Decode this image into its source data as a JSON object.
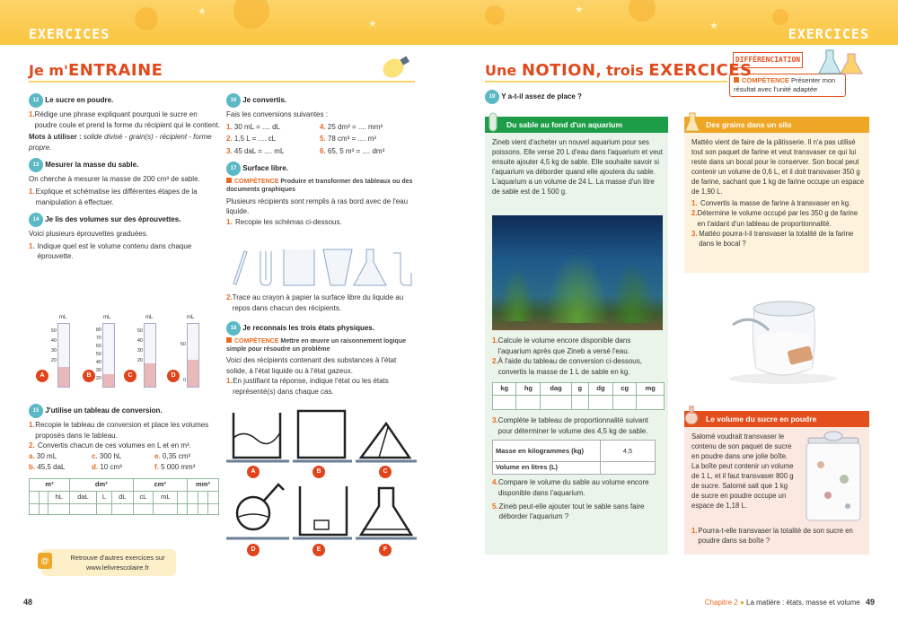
{
  "header": {
    "left": "EXERCICES",
    "right": "EXERCICES"
  },
  "left": {
    "title_a": "Je m'",
    "title_b": "ENTRAINE",
    "ex12": {
      "num": "12",
      "title": "Le sucre en poudre.",
      "q1": "1.",
      "q1_text": "Rédige une phrase expliquant pourquoi le sucre en poudre coule et prend la forme du récipient qui le contient.",
      "mots_label": "Mots à utiliser :",
      "mots": "solide divisé - grain(s) - récipient - forme propre."
    },
    "ex13": {
      "num": "13",
      "title": "Mesurer la masse du sable.",
      "intro": "On cherche à mesurer la masse de 200 cm³ de sable.",
      "q1": "1.",
      "q1_text": "Explique et schématise les différentes étapes de la manipulation à effectuer."
    },
    "ex14": {
      "num": "14",
      "title": "Je lis des volumes sur des éprouvettes.",
      "intro": "Voici plusieurs éprouvettes graduées.",
      "q1": "1.",
      "q1_text": "Indique quel est le volume contenu dans chaque éprouvette.",
      "unit": "mL",
      "labels": [
        "A",
        "B",
        "C",
        "D"
      ],
      "tickA": [
        "50",
        "40",
        "30",
        "20"
      ],
      "tickB": [
        "80",
        "70",
        "60",
        "50",
        "40",
        "30",
        "20"
      ],
      "tickC": [
        "50",
        "40",
        "30",
        "20"
      ],
      "tickD": [
        "50",
        "0"
      ]
    },
    "ex15": {
      "num": "15",
      "title": "J'utilise un tableau de conversion.",
      "q1": "1.",
      "q1_text": "Recopie le tableau de conversion et place les volumes proposés dans le tableau.",
      "q2": "2.",
      "q2_text": "Convertis chacun de ces volumes en L et en m³.",
      "items": [
        [
          "a.",
          "30 mL"
        ],
        [
          "b.",
          "45,5 daL"
        ],
        [
          "c.",
          "300 hL"
        ],
        [
          "d.",
          "10 cm³"
        ],
        [
          "e.",
          "0,35 cm³"
        ],
        [
          "f.",
          "5 000 mm³"
        ]
      ],
      "table_top": [
        "m³",
        "dm³",
        "cm³",
        "mm³"
      ],
      "table_bottom": [
        "hL",
        "daL",
        "L",
        "dL",
        "cL",
        "mL"
      ]
    },
    "ex16": {
      "num": "16",
      "title": "Je convertis.",
      "intro": "Fais les conversions suivantes :",
      "items": [
        [
          "1.",
          "30 mL = .... dL"
        ],
        [
          "2.",
          "1,5 L = .... cL"
        ],
        [
          "3.",
          "45 daL = .... mL"
        ],
        [
          "4.",
          "25 dm³ = .... mm³"
        ],
        [
          "5.",
          "78 cm³ = .... m³"
        ],
        [
          "6.",
          "65, 5 m³ = .... dm³"
        ]
      ]
    },
    "ex17": {
      "num": "17",
      "title": "Surface libre.",
      "comp_label": "COMPÉTENCE",
      "comp_text": "Produire et transformer des tableaux ou des documents graphiques",
      "intro": "Plusieurs récipients sont remplis à ras bord avec de l'eau liquide.",
      "q1": "1.",
      "q1_text": "Recopie les schémas ci-dessous.",
      "q2": "2.",
      "q2_text": "Trace au crayon à papier la surface libre du liquide au repos dans chacun des récipients."
    },
    "ex18": {
      "num": "18",
      "title": "Je reconnais les trois états physiques.",
      "comp_label": "COMPÉTENCE",
      "comp_text": "Mettre en œuvre un raisonnement logique simple pour résoudre un problème",
      "intro": "Voici des récipients contenant des substances à l'état solide, à l'état liquide ou à l'état gazeux.",
      "q1": "1.",
      "q1_text": "En justifiant ta réponse, indique l'état ou les états représenté(s) dans chaque cas.",
      "labels": [
        "A",
        "B",
        "C",
        "D",
        "E",
        "F"
      ]
    },
    "footer_note": "Retrouve d'autres exercices sur www.lelivrescolaire.fr",
    "page": "48"
  },
  "right": {
    "title_a": "Une ",
    "title_b": "NOTION",
    ", trois ": "",
    "title_c": ", trois ",
    "title_d": "EXERCICES",
    "diff": {
      "label": "DIFFÉRENCIATION",
      "comp_label": "COMPÉTENCE",
      "comp_text": "Présenter mon résultat avec l'unité adaptée"
    },
    "ex19": {
      "num": "19",
      "title": "Y a-t-il assez de place ?"
    },
    "aquarium": {
      "title": "Du sable au fond d'un aquarium",
      "text": "Zineb vient d'acheter un nouvel aquarium pour ses poissons. Elle verse 20 L d'eau dans l'aquarium et veut ensuite ajouter 4,5 kg de sable. Elle souhaite savoir si l'aquarium va déborder quand elle ajoutera du sable. L'aquarium a un volume de 24 L. La masse d'un litre de sable est de 1 500 g.",
      "q1": "1.",
      "q1_text": "Calcule le volume encore disponible dans l'aquarium après que Zineb a versé l'eau.",
      "q2": "2.",
      "q2_text": "À l'aide du tableau de conversion ci-dessous, convertis la masse de 1 L de sable en kg.",
      "table": [
        "kg",
        "hg",
        "dag",
        "g",
        "dg",
        "cg",
        "mg"
      ],
      "q3": "3.",
      "q3_text": "Complète le tableau de proportionnalité suivant pour déterminer le volume des 4,5 kg de sable.",
      "row1": "Masse en kilogrammes (kg)",
      "row1_val": "4,5",
      "row2": "Volume en litres (L)",
      "q4": "4.",
      "q4_text": "Compare le volume du sable au volume encore disponible dans l'aquarium.",
      "q5": "5.",
      "q5_text": "Zineb peut-elle ajouter tout le sable sans faire déborder l'aquarium ?"
    },
    "silo": {
      "title": "Des grains dans un silo",
      "text": "Mattéo vient de faire de la pâtisserie. Il n'a pas utilisé tout son paquet de farine et veut transvaser ce qui lui reste dans un bocal pour le conserver. Son bocal peut contenir un volume de 0,6 L, et il doit transvaser 350 g de farine, sachant que 1 kg de farine occupe un espace de 1,90 L.",
      "q1": "1.",
      "q1_text": "Convertis la masse de farine à transvaser en kg.",
      "q2": "2.",
      "q2_text": "Détermine le volume occupé par les 350 g de farine en t'aidant d'un tableau de proportionnalité.",
      "q3": "3.",
      "q3_text": "Mattéo pourra-t-il transvaser la totalité de la farine dans le bocal ?"
    },
    "sucre": {
      "title": "Le volume du sucre en poudre",
      "text": "Salomé voudrait transvaser le contenu de son paquet de sucre en poudre dans une jolie boîte. La boîte peut contenir un volume de 1 L, et il faut transvaser 800 g de sucre. Salomé sait que 1 kg de sucre en poudre occupe un espace de 1,18 L.",
      "q1": "1.",
      "q1_text": "Pourra-t-elle transvaser la totalité de son sucre en poudre dans sa boîte ?"
    },
    "footer_chapter": "Chapitre 2",
    "footer_title": "La matière : états, masse et volume",
    "page": "49"
  }
}
